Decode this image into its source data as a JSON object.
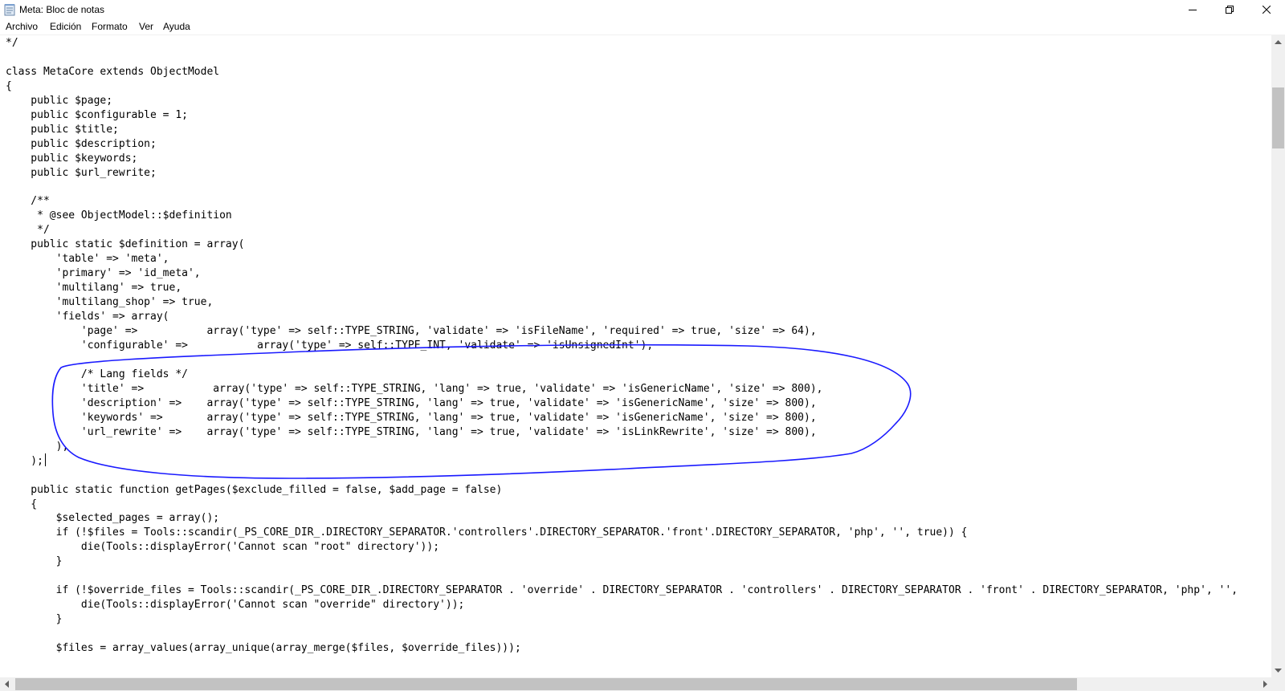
{
  "window": {
    "title": "Meta: Bloc de notas",
    "icon": "notepad-icon",
    "controls": [
      "minimize-icon",
      "restore-icon",
      "close-icon"
    ]
  },
  "menu": {
    "items": [
      "Archivo",
      "Edición",
      "Formato",
      "Ver",
      "Ayuda"
    ]
  },
  "editor": {
    "lines": [
      "*/",
      "",
      "class MetaCore extends ObjectModel",
      "{",
      "    public $page;",
      "    public $configurable = 1;",
      "    public $title;",
      "    public $description;",
      "    public $keywords;",
      "    public $url_rewrite;",
      "",
      "    /**",
      "     * @see ObjectModel::$definition",
      "     */",
      "    public static $definition = array(",
      "        'table' => 'meta',",
      "        'primary' => 'id_meta',",
      "        'multilang' => true,",
      "        'multilang_shop' => true,",
      "        'fields' => array(",
      "            'page' =>           array('type' => self::TYPE_STRING, 'validate' => 'isFileName', 'required' => true, 'size' => 64),",
      "            'configurable' =>           array('type' => self::TYPE_INT, 'validate' => 'isUnsignedInt'),",
      "",
      "            /* Lang fields */",
      "            'title' =>           array('type' => self::TYPE_STRING, 'lang' => true, 'validate' => 'isGenericName', 'size' => 800),",
      "            'description' =>    array('type' => self::TYPE_STRING, 'lang' => true, 'validate' => 'isGenericName', 'size' => 800),",
      "            'keywords' =>       array('type' => self::TYPE_STRING, 'lang' => true, 'validate' => 'isGenericName', 'size' => 800),",
      "            'url_rewrite' =>    array('type' => self::TYPE_STRING, 'lang' => true, 'validate' => 'isLinkRewrite', 'size' => 800),",
      "        ),",
      "    );",
      "",
      "    public static function getPages($exclude_filled = false, $add_page = false)",
      "    {",
      "        $selected_pages = array();",
      "        if (!$files = Tools::scandir(_PS_CORE_DIR_.DIRECTORY_SEPARATOR.'controllers'.DIRECTORY_SEPARATOR.'front'.DIRECTORY_SEPARATOR, 'php', '', true)) {",
      "            die(Tools::displayError('Cannot scan \"root\" directory'));",
      "        }",
      "",
      "        if (!$override_files = Tools::scandir(_PS_CORE_DIR_.DIRECTORY_SEPARATOR . 'override' . DIRECTORY_SEPARATOR . 'controllers' . DIRECTORY_SEPARATOR . 'front' . DIRECTORY_SEPARATOR, 'php', '',",
      "            die(Tools::displayError('Cannot scan \"override\" directory'));",
      "        }",
      "",
      "        $files = array_values(array_unique(array_merge($files, $override_files)));"
    ]
  },
  "annotation": {
    "type": "hand-drawn ellipse",
    "color": "#1a1aff"
  },
  "scrollbars": {
    "vertical_position": 0.07,
    "horizontal_position": 0.0
  },
  "colors": {
    "background": "#ffffff",
    "chrome": "#f0f0f0",
    "scroll_thumb": "#c2c2c2"
  }
}
